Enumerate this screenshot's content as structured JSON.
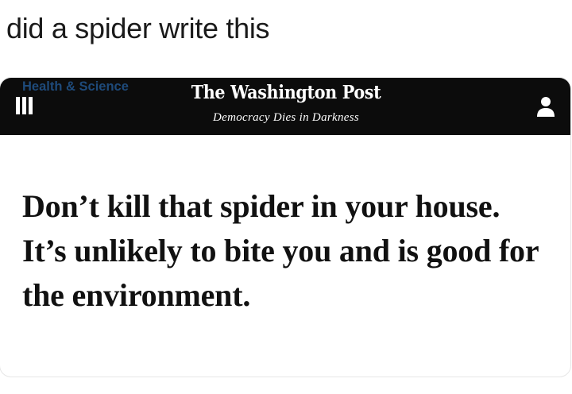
{
  "caption": "did a spider write this",
  "header": {
    "masthead": "The Washington Post",
    "tagline": "Democracy Dies in Darkness",
    "menu_icon": "hamburger-menu-icon",
    "account_icon": "user-account-icon"
  },
  "article": {
    "section": "Health & Science",
    "headline": "Don’t kill that spider in your house. It’s unlikely to bite you and is good for the environment."
  },
  "colors": {
    "header_background": "#0c0c0c",
    "section_label": "#1e4a7a",
    "headline": "#111111"
  }
}
